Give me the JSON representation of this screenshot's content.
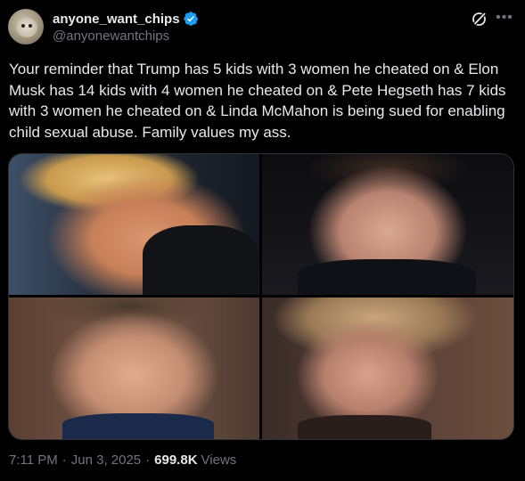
{
  "author": {
    "display_name": "anyone_want_chips",
    "handle": "@anyonewantchips",
    "verified": true,
    "verified_color": "#1d9bf0"
  },
  "tweet": {
    "text": "Your reminder that Trump has 5 kids with 3 women he cheated on & Elon Musk has 14 kids with 4 women he cheated on & Pete Hegseth has 7 kids with 3 women he cheated on & Linda McMahon is being sued for enabling child sexual abuse. Family values my ass.",
    "time": "7:11 PM",
    "separator": "·",
    "date": "Jun 3, 2025",
    "views_count": "699.8K",
    "views_label": "Views"
  },
  "icons": {
    "verified": "verified-badge-icon",
    "grok": "grok-icon",
    "more": "more-options-icon"
  },
  "colors": {
    "background": "#000000",
    "text_primary": "#e7e9ea",
    "text_secondary": "#71767b",
    "border": "#2f3336"
  }
}
